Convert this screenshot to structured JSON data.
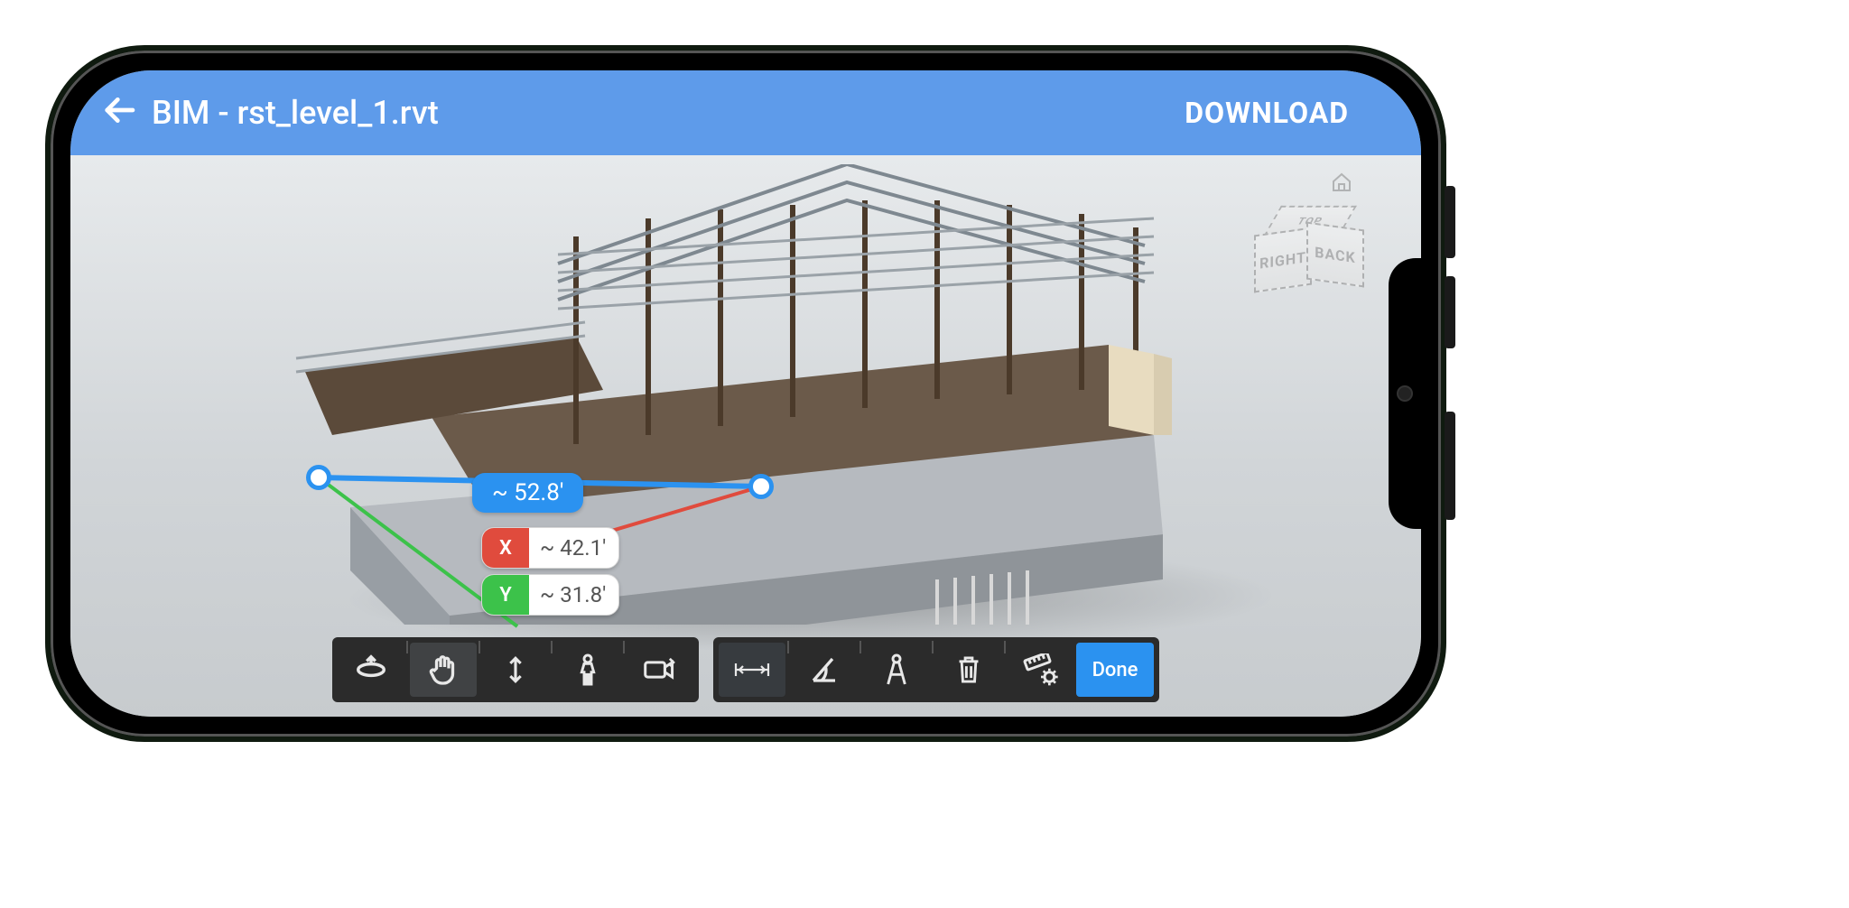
{
  "header": {
    "title": "BIM - rst_level_1.rvt",
    "download_label": "DOWNLOAD"
  },
  "viewcube": {
    "right": "RIGHT",
    "back": "BACK",
    "top": "TOP"
  },
  "measurement": {
    "main": "~ 52.8'",
    "x_tag": "X",
    "x_val": "~ 42.1'",
    "y_tag": "Y",
    "y_val": "~ 31.8'"
  },
  "toolbar": {
    "done_label": "Done"
  }
}
